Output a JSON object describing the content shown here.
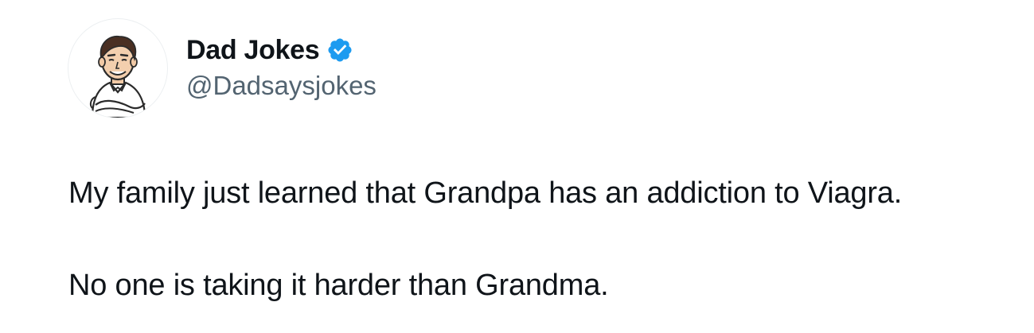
{
  "tweet": {
    "author": {
      "display_name": "Dad Jokes",
      "handle": "@Dadsaysjokes",
      "verified": true,
      "avatar_icon": "cartoon-man-avatar-icon",
      "verified_color": "#1d9bf0"
    },
    "text_lines": [
      "My family just learned that Grandpa has an addiction to Viagra.",
      "No one is taking it harder than Grandma."
    ]
  }
}
